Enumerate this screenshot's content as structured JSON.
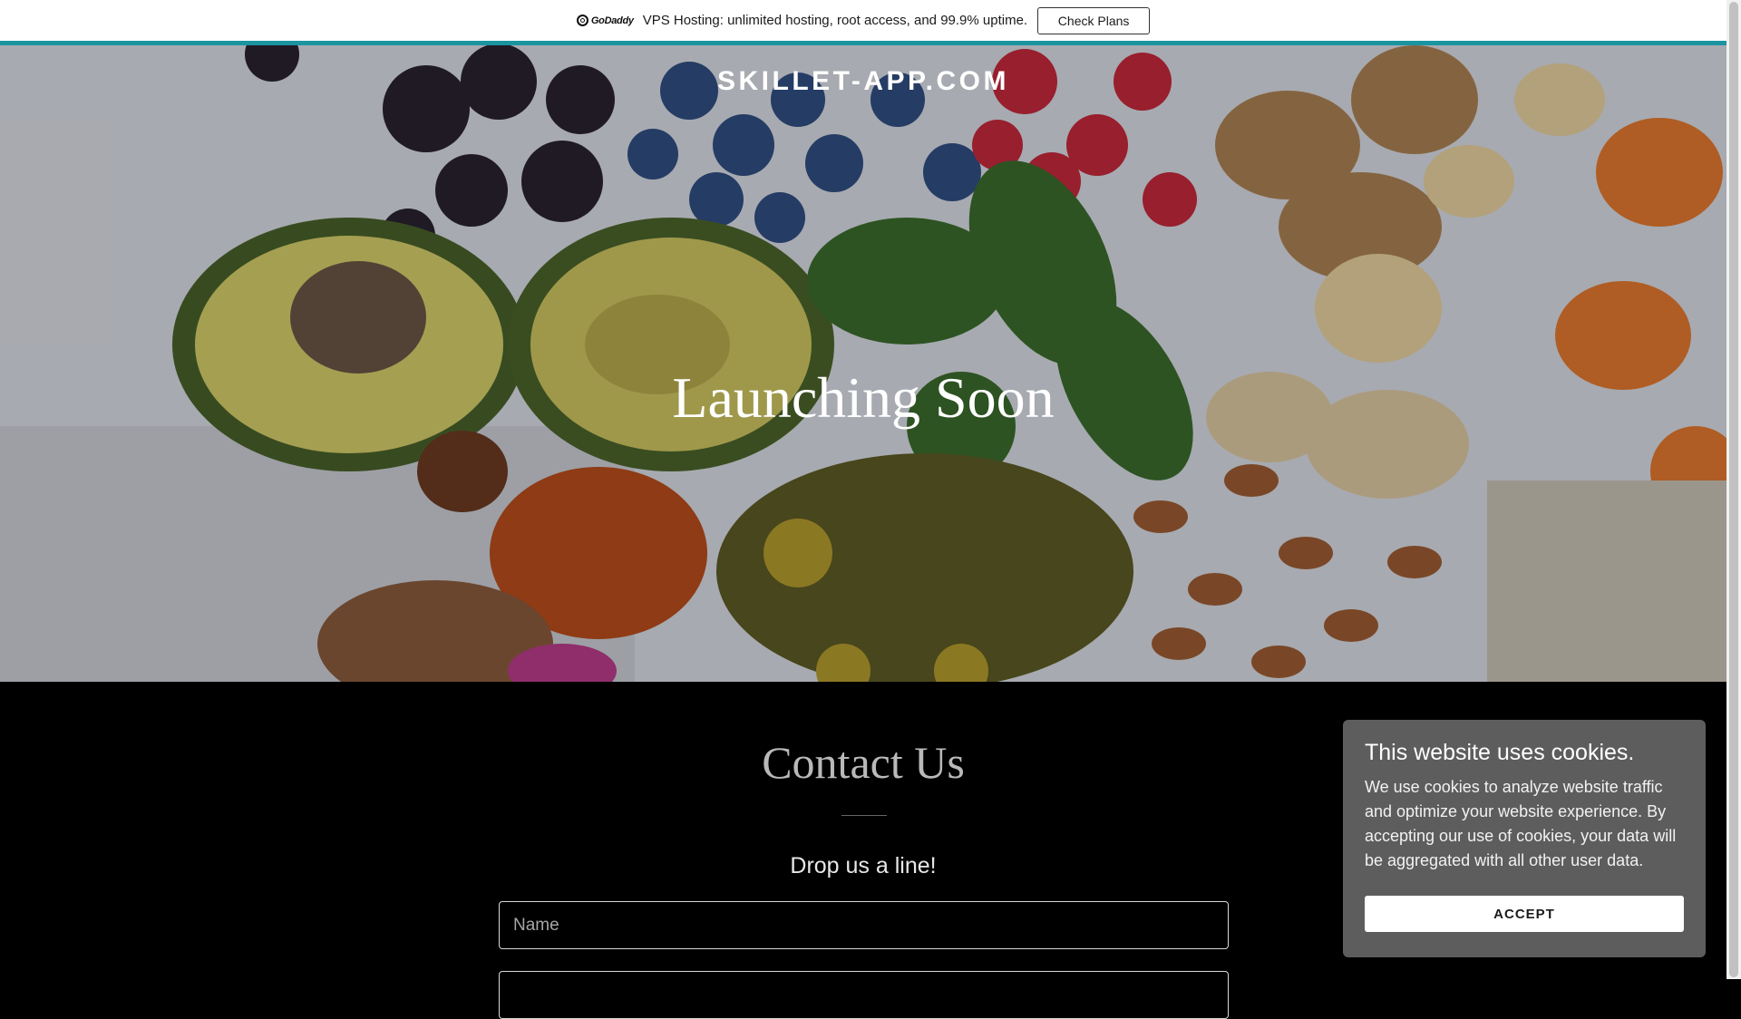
{
  "promo_bar": {
    "brand": "GoDaddy",
    "message": "VPS Hosting: unlimited hosting, root access, and 99.9% uptime.",
    "cta_label": "Check Plans",
    "accent_color": "#1a95a0"
  },
  "hero": {
    "site_title": "SKILLET-APP.COM",
    "heading": "Launching Soon"
  },
  "contact": {
    "title": "Contact Us",
    "subtitle": "Drop us a line!",
    "name_placeholder": "Name",
    "email_placeholder": ""
  },
  "cookie_banner": {
    "title": "This website uses cookies.",
    "body": "We use cookies to analyze website traffic and optimize your website experience. By accepting our use of cookies, your data will be aggregated with all other user data.",
    "accept_label": "ACCEPT"
  },
  "colors": {
    "page_background": "#000000",
    "cookie_panel": "#5d5d5d"
  }
}
